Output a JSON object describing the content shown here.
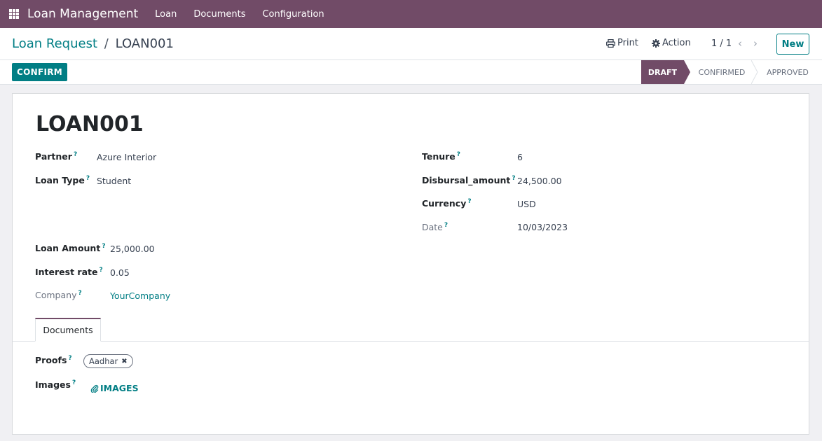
{
  "navbar": {
    "app_name": "Loan Management",
    "menu": [
      "Loan",
      "Documents",
      "Configuration"
    ]
  },
  "breadcrumb": {
    "parent": "Loan Request",
    "separator": "/",
    "current": "LOAN001"
  },
  "toolbar": {
    "print_label": "Print",
    "action_label": "Action",
    "pager": "1 / 1",
    "new_label": "New"
  },
  "statusbar": {
    "confirm_label": "CONFIRM",
    "stages": [
      "DRAFT",
      "CONFIRMED",
      "APPROVED"
    ],
    "active_stage": "DRAFT"
  },
  "form": {
    "title": "LOAN001",
    "partner": {
      "label": "Partner",
      "value": "Azure Interior"
    },
    "loan_type": {
      "label": "Loan Type",
      "value": "Student"
    },
    "tenure": {
      "label": "Tenure",
      "value": "6"
    },
    "disbursal_amount": {
      "label": "Disbursal_amount",
      "value": "24,500.00"
    },
    "currency": {
      "label": "Currency",
      "value": "USD"
    },
    "date": {
      "label": "Date",
      "value": "10/03/2023"
    },
    "loan_amount": {
      "label": "Loan Amount",
      "value": "25,000.00"
    },
    "interest_rate": {
      "label": "Interest rate",
      "value": "0.05"
    },
    "company": {
      "label": "Company",
      "value": "YourCompany"
    },
    "help_marker": "?"
  },
  "tabs": {
    "documents": "Documents"
  },
  "documents": {
    "proofs_label": "Proofs",
    "proof_tag": "Aadhar",
    "images_label": "Images",
    "images_button": "IMAGES"
  },
  "colors": {
    "brand": "#714b67",
    "accent": "#017e84"
  },
  "icons": [
    "apps-grid-icon",
    "printer-icon",
    "gear-icon",
    "chevron-left-icon",
    "chevron-right-icon",
    "close-icon",
    "paperclip-icon",
    "help-icon"
  ]
}
